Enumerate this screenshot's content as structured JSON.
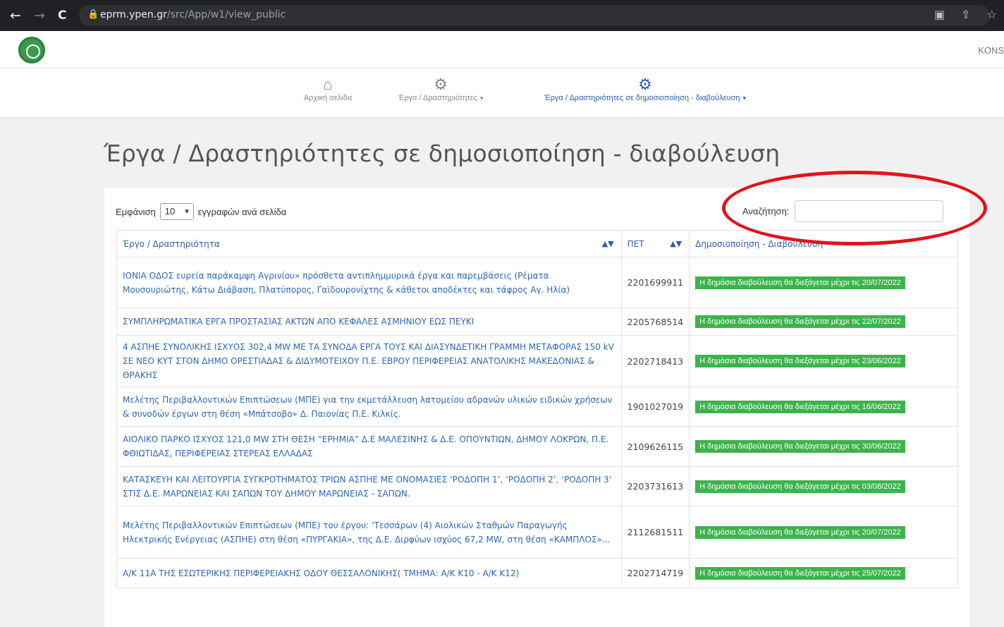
{
  "browser": {
    "back": "←",
    "forward": "→",
    "reload": "C",
    "url_host": "eprm.ypen.gr",
    "url_path": "/src/App/w1/view_public"
  },
  "header": {
    "user_name": "KONST"
  },
  "nav": [
    {
      "label": "Αρχική σελίδα",
      "icon": "home-icon"
    },
    {
      "label": "Έργα / Δραστηριότητες",
      "icon": "gear-icon",
      "caret": "▾"
    },
    {
      "label": "Έργα / Δραστηριότητες σε δημοσιοποίηση - διαβούλευση",
      "icon": "gear-icon",
      "caret": "▾"
    }
  ],
  "page_title": "Έργα / Δραστηριότητες σε δημοσιοποίηση - διαβούλευση",
  "length": {
    "prefix": "Εμφάνιση",
    "value": "10",
    "suffix": "εγγραφών ανά σελίδα"
  },
  "search": {
    "label": "Αναζήτηση:",
    "value": ""
  },
  "table": {
    "headers": [
      "Έργο / Δραστηριότητα",
      "ΠΕΤ",
      "Δημοσιοποίηση - Διαβούλευση"
    ],
    "rows": [
      {
        "project": "ΙΟΝΙΑ ΟΔΟΣ ευρεία παράκαμψη Αγρινίου» πρόσθετα αντιπλημμυρικά έργα και παρεμβάσεις (Ρέματα Μουσουριώτης, Κάτω Διάβαση, Πλατύπορος, Γαϊδουρονίχτης & κάθετοι αποδέκτες και τάφρος Αγ. Ηλία)",
        "pet": "2201699911",
        "status": "Η δημόσια διαβούλευση θα διεξάγεται μέχρι τις 20/07/2022"
      },
      {
        "project": "ΣΥΜΠΛΗΡΩΜΑΤΙΚΑ ΕΡΓΑ ΠΡΟΣΤΑΣΙΑΣ ΑΚΤΩΝ ΑΠΟ ΚΕΦΑΛΕΣ ΑΣΜΗΝΙΟΥ ΕΩΣ ΠΕΥΚΙ",
        "pet": "2205768514",
        "status": "Η δημόσια διαβούλευση θα διεξάγεται μέχρι τις 22/07/2022"
      },
      {
        "project": "4 ΑΣΠΗΕ ΣΥΝΟΛΙΚΗΣ ΙΣΧΥΟΣ 302,4 MW ΜΕ ΤΑ ΣΥΝΟΔΑ ΕΡΓΑ ΤΟΥΣ ΚΑΙ ΔΙΑΣΥΝΔΕΤΙΚΗ ΓΡΑΜΜΗ ΜΕΤΑΦΟΡΑΣ 150 kV ΣΕ ΝΕΟ ΚΥΤ ΣΤΟΝ ΔΗΜΟ ΟΡΕΣΤΙΑΔΑΣ & ΔΙΔΥΜΟΤΕΙΧΟΥ Π.Ε. ΕΒΡΟΥ ΠΕΡΙΦΕΡΕΙΑΣ ΑΝΑΤΟΛΙΚΗΣ ΜΑΚΕΔΟΝΙΑΣ & ΘΡΑΚΗΣ",
        "pet": "2202718413",
        "status": "Η δημόσια διαβούλευση θα διεξάγεται μέχρι τις 23/06/2022"
      },
      {
        "project": "Μελέτης Περιβαλλοντικών Επιπτώσεων (ΜΠΕ) για την εκμετάλλευση λατομείου αδρανών υλικών ειδικών χρήσεων & συνοδών έργων στη θέση «Μπάτσοβο» Δ. Παιονίας Π.Ε. Κιλκίς.",
        "pet": "1901027019",
        "status": "Η δημόσια διαβούλευση θα διεξάγεται μέχρι τις 16/06/2022"
      },
      {
        "project": "ΑΙΟΛΙΚΟ ΠΑΡΚΟ ΙΣΧΥΟΣ 121,0 MW ΣΤΗ ΘΕΣΗ “ΕΡΗΜΙΑ” Δ.Ε ΜΑΛΕΣΙΝΗΣ & Δ.Ε. ΟΠΟΥΝΤΙΩΝ, ΔΗΜΟΥ ΛΟΚΡΩΝ, Π.Ε. ΦΘΙΩΤΙΔΑΣ, ΠΕΡΙΦΕΡΕΙΑΣ ΣΤΕΡΕΑΣ ΕΛΛΑΔΑΣ",
        "pet": "2109626115",
        "status": "Η δημόσια διαβούλευση θα διεξάγεται μέχρι τις 30/06/2022"
      },
      {
        "project": "ΚΑΤΑΣΚΕΥΗ ΚΑΙ ΛΕΙΤΟΥΡΓΙΑ ΣΥΓΚΡΟΤΗΜΑΤΟΣ ΤΡΙΩΝ ΑΣΠΗΕ ΜΕ ΟΝΟΜΑΣΙΕΣ ‘ΡΟΔΟΠΗ 1’, ‘ΡΟΔΟΠΗ 2’, ‘ΡΟΔΟΠΗ 3’ ΣΤΙΣ Δ.Ε. ΜΑΡΩΝΕΙΑΣ ΚΑΙ ΣΑΠΩΝ ΤΟΥ ΔΗΜΟΥ ΜΑΡΩΝΕΙΑΣ - ΣΑΠΩΝ.",
        "pet": "2203731613",
        "status": "Η δημόσια διαβούλευση θα διεξάγεται μέχρι τις 03/08/2022"
      },
      {
        "project": "Μελέτης Περιβαλλοντικών Επιπτώσεων (ΜΠΕ) του έργου: ‘Τεσσάρων (4) Αιολικών Σταθμών Παραγωγής Ηλεκτρικής Ενέργειας (ΑΣΠΗΕ) στη θέση «ΠΥΡΓΑΚΙΑ», της Δ.Ε. Διρφύων ισχύος 67,2 MW, στη θέση «ΚΑΜΠΛΟΣ»...",
        "pet": "2112681511",
        "status": "Η δημόσια διαβούλευση θα διεξάγεται μέχρι τις 20/07/2022"
      },
      {
        "project": "Α/Κ 11Α ΤΗΣ ΕΣΩΤΕΡΙΚΗΣ ΠΕΡΙΦΕΡΕΙΑΚΗΣ ΟΔΟΥ ΘΕΣΣΑΛΟΝΙΚΗΣ( ΤΜΗΜΑ: Α/Κ Κ10 - Α/Κ Κ12)",
        "pet": "2202714719",
        "status": "Η δημόσια διαβούλευση θα διεξάγεται μέχρι τις 25/07/2022"
      }
    ]
  },
  "colors": {
    "link": "#2a67b8",
    "badge": "#3cb44b",
    "annotation": "#e0141c"
  }
}
